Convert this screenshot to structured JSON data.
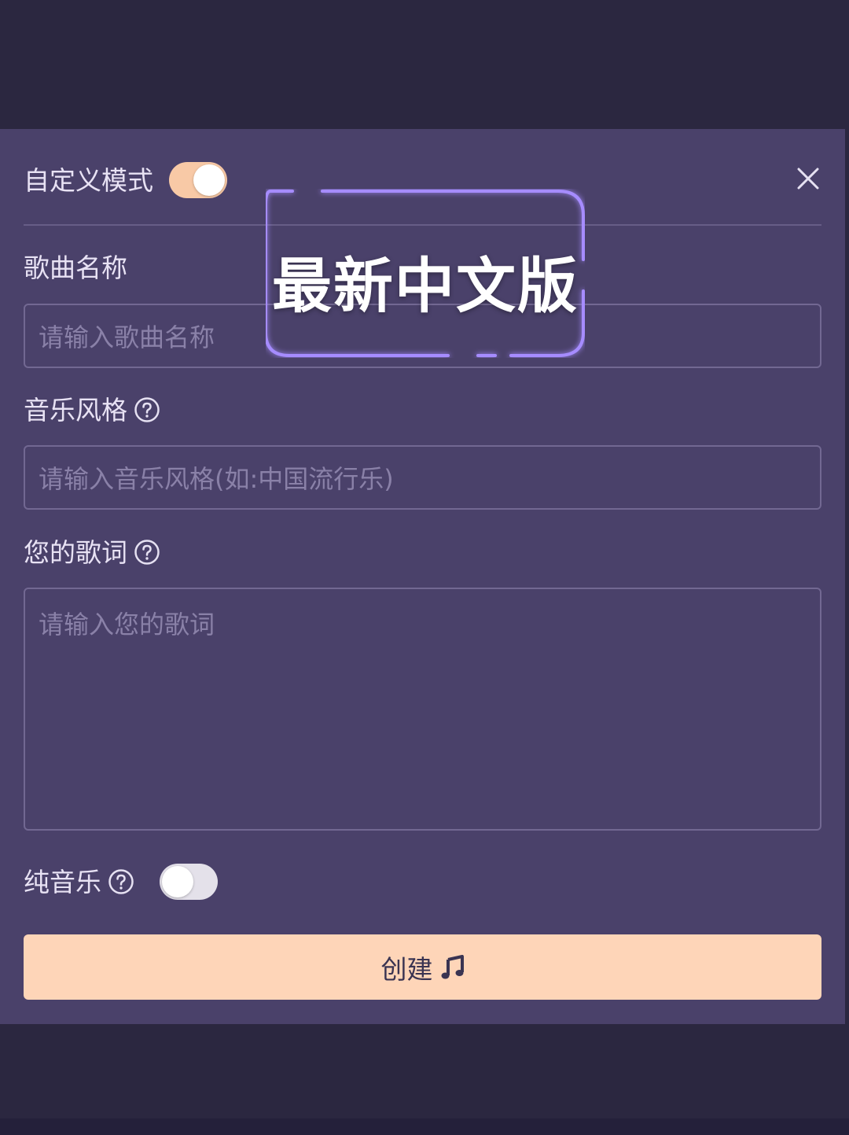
{
  "header": {
    "custom_mode_label": "自定义模式",
    "custom_mode_on": true
  },
  "form": {
    "song_name_label": "歌曲名称",
    "song_name_placeholder": "请输入歌曲名称",
    "song_name_value": "",
    "style_label": "音乐风格",
    "style_placeholder": "请输入音乐风格(如:中国流行乐)",
    "style_value": "",
    "lyrics_label": "您的歌词",
    "lyrics_placeholder": "请输入您的歌词",
    "lyrics_value": "",
    "instrumental_label": "纯音乐",
    "instrumental_on": false
  },
  "actions": {
    "create_label": "创建"
  },
  "overlay": {
    "badge_text": "最新中文版"
  },
  "icons": {
    "close": "close-icon",
    "help": "help-circle-icon",
    "music": "music-note-icon"
  },
  "colors": {
    "panel_bg": "#4a416a",
    "page_bg": "#2b2740",
    "accent": "#fed5b8",
    "toggle_on": "#f8c9a6",
    "glow": "#8f73ff"
  }
}
